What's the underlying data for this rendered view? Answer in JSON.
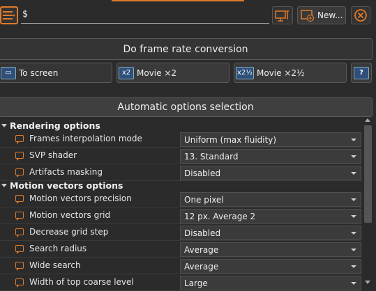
{
  "toolbar": {
    "input_value": "$",
    "new_label": "New..."
  },
  "actions": {
    "do_conversion": "Do frame rate conversion",
    "to_screen": "To screen",
    "movie_x2": "Movie ×2",
    "movie_x25": "Movie ×2½",
    "x2_badge": "x2",
    "x25_badge": "x2½",
    "help": "?"
  },
  "auto_options": "Automatic options selection",
  "rendering": {
    "title": "Rendering options",
    "rows": [
      {
        "label": "Frames interpolation mode",
        "value": "Uniform (max fluidity)"
      },
      {
        "label": "SVP shader",
        "value": "13. Standard"
      },
      {
        "label": "Artifacts masking",
        "value": "Disabled"
      }
    ]
  },
  "motion": {
    "title": "Motion vectors options",
    "rows": [
      {
        "label": "Motion vectors precision",
        "value": "One pixel"
      },
      {
        "label": "Motion vectors grid",
        "value": "12 px. Average 2"
      },
      {
        "label": "Decrease grid step",
        "value": "Disabled"
      },
      {
        "label": "Search radius",
        "value": "Average"
      },
      {
        "label": "Wide search",
        "value": "Average"
      },
      {
        "label": "Width of top coarse level",
        "value": "Large"
      }
    ]
  },
  "colors": {
    "accent": "#e07b2a",
    "background": "#2b2b2b"
  },
  "icons": [
    "menu-icon",
    "monitor-settings-icon",
    "new-profile-icon",
    "close-icon",
    "screen-icon",
    "help-icon"
  ]
}
